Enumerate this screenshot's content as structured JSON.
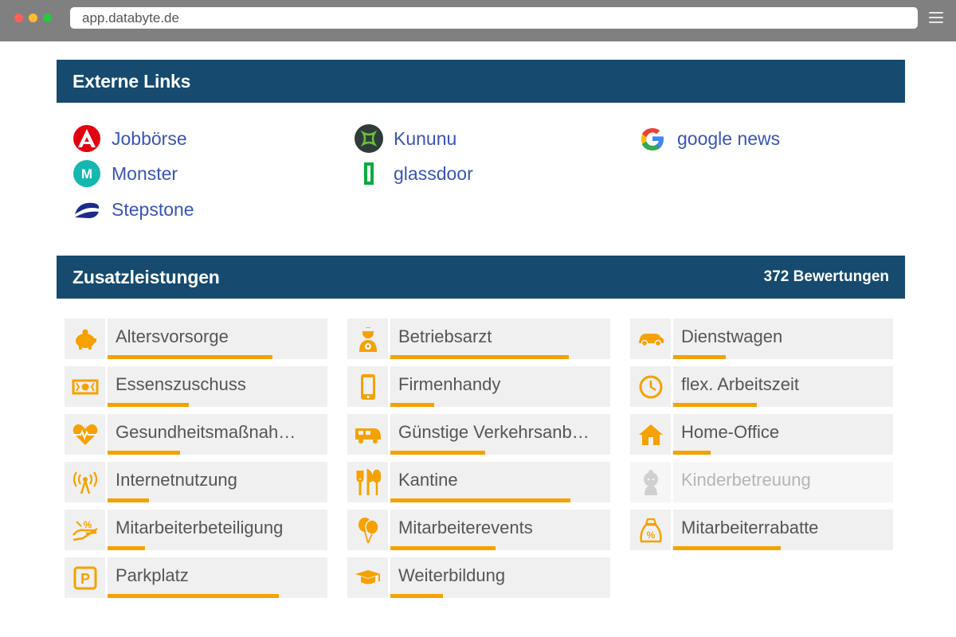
{
  "browser": {
    "url": "app.databyte.de"
  },
  "external_links": {
    "title": "Externe Links",
    "items": [
      {
        "label": "Jobbörse",
        "icon": "arbeitsagentur-logo-icon"
      },
      {
        "label": "Kununu",
        "icon": "kununu-logo-icon"
      },
      {
        "label": "google news",
        "icon": "google-logo-icon"
      },
      {
        "label": "Monster",
        "icon": "monster-logo-icon"
      },
      {
        "label": "glassdoor",
        "icon": "glassdoor-logo-icon"
      },
      {
        "label": "Stepstone",
        "icon": "stepstone-logo-icon"
      }
    ]
  },
  "benefits": {
    "title": "Zusatzleistungen",
    "review_count": "372 Bewertungen",
    "accent_color": "#f5a100",
    "items": [
      {
        "label": "Altersvorsorge",
        "icon": "piggy-bank-icon",
        "share": 0.75
      },
      {
        "label": "Betriebsarzt",
        "icon": "doctor-icon",
        "share": 0.81
      },
      {
        "label": "Dienstwagen",
        "icon": "car-icon",
        "share": 0.24
      },
      {
        "label": "Essenszuschuss",
        "icon": "money-icon",
        "share": 0.37
      },
      {
        "label": "Firmenhandy",
        "icon": "mobile-phone-icon",
        "share": 0.2
      },
      {
        "label": "flex. Arbeitszeit",
        "icon": "clock-icon",
        "share": 0.38
      },
      {
        "label": "Gesundheitsmaßnah…",
        "icon": "heartbeat-icon",
        "share": 0.33
      },
      {
        "label": "Günstige Verkehrsanb…",
        "icon": "train-icon",
        "share": 0.43
      },
      {
        "label": "Home-Office",
        "icon": "house-icon",
        "share": 0.17
      },
      {
        "label": "Internetnutzung",
        "icon": "antenna-icon",
        "share": 0.19
      },
      {
        "label": "Kantine",
        "icon": "cutlery-icon",
        "share": 0.82
      },
      {
        "label": "Kinderbetreuung",
        "icon": "baby-icon",
        "share": 0,
        "disabled": true
      },
      {
        "label": "Mitarbeiterbeteiligung",
        "icon": "percent-hand-icon",
        "share": 0.17
      },
      {
        "label": "Mitarbeiterevents",
        "icon": "balloons-icon",
        "share": 0.48
      },
      {
        "label": "Mitarbeiterrabatte",
        "icon": "discount-bag-icon",
        "share": 0.49
      },
      {
        "label": "Parkplatz",
        "icon": "parking-icon",
        "share": 0.78
      },
      {
        "label": "Weiterbildung",
        "icon": "graduation-cap-icon",
        "share": 0.24
      }
    ]
  }
}
